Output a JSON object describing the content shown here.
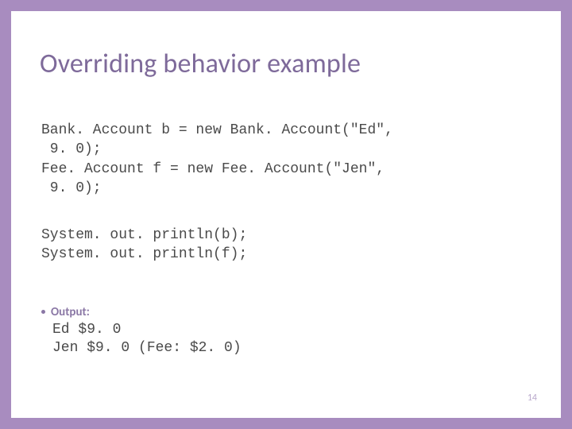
{
  "title": "Overriding behavior example",
  "code1": "Bank. Account b = new Bank. Account(\"Ed\",\n 9. 0);\nFee. Account f = new Fee. Account(\"Jen\",\n 9. 0);",
  "code2": "System. out. println(b);\nSystem. out. println(f);",
  "outputLabel": "Output:",
  "outputCode": "Ed $9. 0\nJen $9. 0 (Fee: $2. 0)",
  "pageNumber": "14"
}
